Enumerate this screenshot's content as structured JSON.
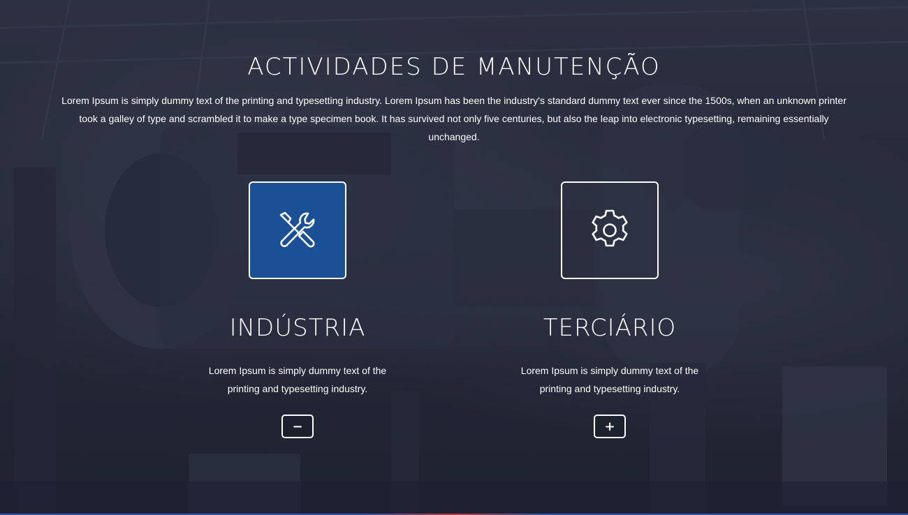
{
  "section": {
    "title": "ACTIVIDADES DE MANUTENÇÃO",
    "intro": "Lorem Ipsum is simply dummy text of the printing and typesetting industry. Lorem Ipsum has been the industry's standard dummy text ever since the 1500s, when an unknown printer took a galley of type and scrambled it to make a type specimen book. It has survived not only five centuries, but also the leap into electronic typesetting, remaining essentially unchanged."
  },
  "cards": [
    {
      "icon": "tools-icon",
      "title": "INDÚSTRIA",
      "text": "Lorem Ipsum is simply dummy text of the printing and typesetting industry.",
      "toggle_symbol": "−",
      "active": true
    },
    {
      "icon": "gear-icon",
      "title": "TERCIÁRIO",
      "text": "Lorem Ipsum is simply dummy text of the printing and typesetting industry.",
      "toggle_symbol": "+",
      "active": false
    }
  ],
  "colors": {
    "accent": "#1b4f96",
    "text": "#ffffff",
    "background_overlay": "#2b3040"
  }
}
